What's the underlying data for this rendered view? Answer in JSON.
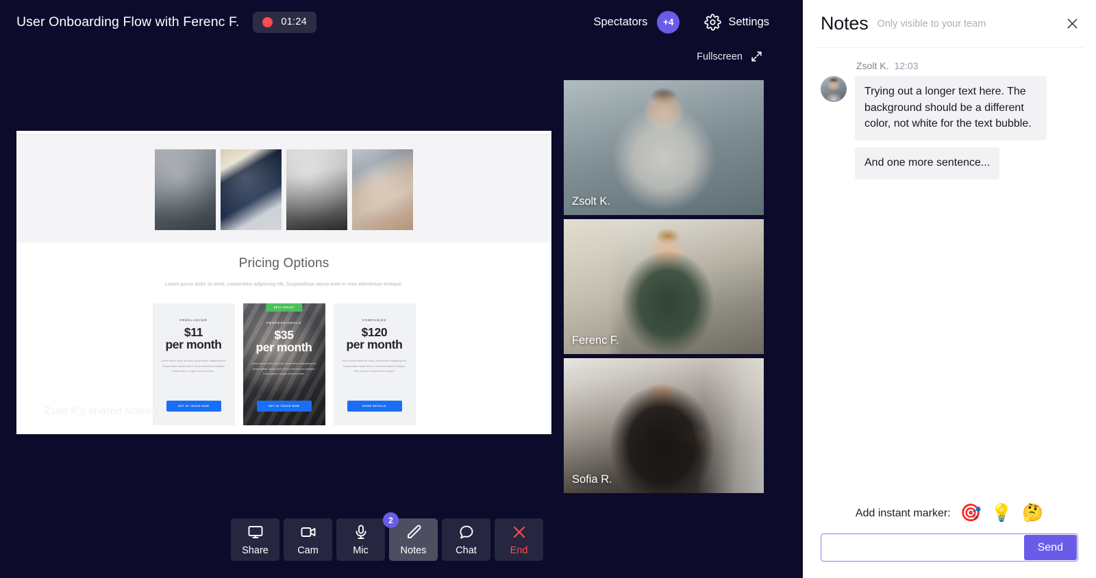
{
  "meeting": {
    "title": "User Onboarding Flow with Ferenc F.",
    "recording_time": "01:24",
    "spectators_label": "Spectators",
    "spectators_badge": "+4",
    "settings_label": "Settings",
    "fullscreen_label": "Fullscreen",
    "accent_purple": "#6b5ce7",
    "record_red": "#ff4d4d",
    "stage_bg": "#0d0b2b"
  },
  "shared_screen": {
    "label": "Zsolt K's shared screen",
    "thumbnails": [
      "photo-camera-thumb",
      "mobile-app-thumb",
      "workspace-thumb",
      "desk-setup-thumb"
    ],
    "pricing": {
      "title": "Pricing Options",
      "subtitle": "Lorem ipsum dolor sit amet, consectetur adipiscing elit. Suspendisse varius enim in eros elementum tristique.",
      "cards": [
        {
          "tier": "FREELANCER",
          "amount": "$11",
          "period": "per month",
          "description": "Lorem ipsum dolor sit amet, consectetur adipiscing elit. Suspendisse varius enim in eros elementum tristique. Duis cursus, mi quis viverra ornare.",
          "button": "GET IN TOUCH NOW",
          "badge": "",
          "featured": false
        },
        {
          "tier": "PROFESSIONALS",
          "amount": "$35",
          "period": "per month",
          "description": "Lorem ipsum dolor sit amet, consectetur adipiscing elit. Suspendisse varius enim in eros elementum tristique. Duis cursus, mi quis viverra ornare.",
          "button": "GET IN TOUCH NOW",
          "badge": "BEST CHOICE",
          "featured": true
        },
        {
          "tier": "COMPANIES",
          "amount": "$120",
          "period": "per month",
          "description": "Lorem ipsum dolor sit amet, consectetur adipiscing elit. Suspendisse varius enim in eros elementum tristique. Duis cursus, mi quis viverra ornare.",
          "button": "MORE DETAILS",
          "badge": "",
          "featured": false
        }
      ]
    }
  },
  "participants": [
    {
      "name": "Zsolt K."
    },
    {
      "name": "Ferenc F."
    },
    {
      "name": "Sofia R."
    }
  ],
  "toolbar": {
    "buttons": [
      {
        "label": "Share",
        "icon": "screen-share-icon",
        "badge": "",
        "active": false,
        "danger": false
      },
      {
        "label": "Cam",
        "icon": "video-camera-icon",
        "badge": "",
        "active": false,
        "danger": false
      },
      {
        "label": "Mic",
        "icon": "microphone-icon",
        "badge": "",
        "active": false,
        "danger": false
      },
      {
        "label": "Notes",
        "icon": "pencil-icon",
        "badge": "2",
        "active": true,
        "danger": false
      },
      {
        "label": "Chat",
        "icon": "speech-bubble-icon",
        "badge": "",
        "active": false,
        "danger": false
      },
      {
        "label": "End",
        "icon": "close-x-icon",
        "badge": "",
        "active": false,
        "danger": true
      }
    ]
  },
  "notes": {
    "title": "Notes",
    "subtitle": "Only visible to your team",
    "close_icon": "close-icon",
    "messages": [
      {
        "author": "Zsolt K.",
        "time": "12:03",
        "bubbles": [
          "Trying out a longer text here. The background should be a different color, not white for the text bubble.",
          "And one more sentence..."
        ]
      }
    ],
    "marker_label": "Add instant marker:",
    "markers": [
      {
        "name": "target-emoji",
        "glyph": "🎯"
      },
      {
        "name": "lightbulb-emoji",
        "glyph": "💡"
      },
      {
        "name": "thinking-face-emoji",
        "glyph": "🤔"
      }
    ],
    "input_value": "",
    "input_placeholder": "",
    "send_label": "Send"
  }
}
